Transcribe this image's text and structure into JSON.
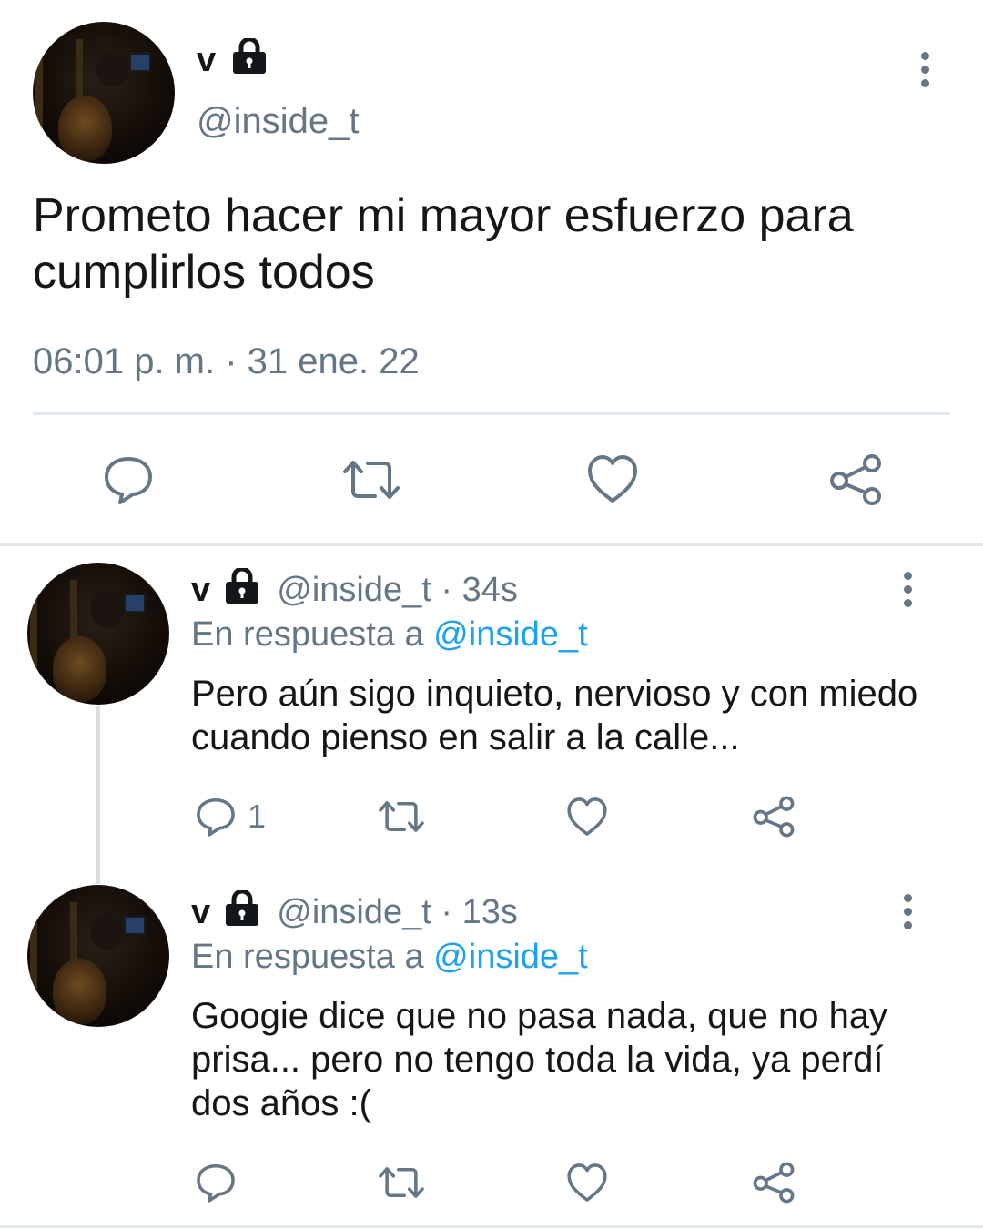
{
  "main_tweet": {
    "display_name": "v",
    "handle": "@inside_t",
    "text": "Prometo hacer mi mayor esfuerzo para cumplirlos todos",
    "timestamp": "06:01 p. m. · 31 ene. 22",
    "actions": [
      "reply-icon",
      "retweet-icon",
      "like-icon",
      "share-icon"
    ]
  },
  "replies": [
    {
      "display_name": "v",
      "handle": "@inside_t",
      "time": "· 34s",
      "reply_prefix": "En respuesta a",
      "reply_to": "@inside_t",
      "text": "Pero aún sigo inquieto, nervioso y con miedo cuando pienso en salir a la calle...",
      "reply_count": "1"
    },
    {
      "display_name": "v",
      "handle": "@inside_t",
      "time": "· 13s",
      "reply_prefix": "En respuesta a",
      "reply_to": "@inside_t",
      "text": "Googie dice que no pasa nada, que no hay prisa... pero no tengo toda la vida, ya perdí dos años :(",
      "reply_count": ""
    }
  ],
  "colors": {
    "text": "#14171a",
    "secondary": "#657786",
    "link": "#1da1f2",
    "divider": "#e1e8ed"
  }
}
